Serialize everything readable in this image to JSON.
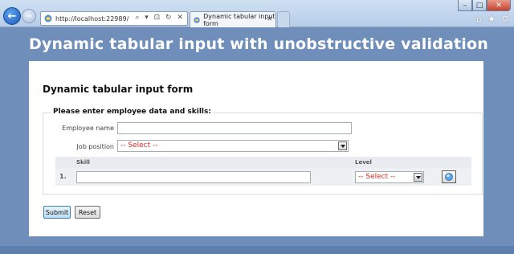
{
  "browser": {
    "address_url": "http://localhost:22989/",
    "address_tools": "⌕ ▾ ⊡ ↻ ✕",
    "tab_title": "Dynamic tabular input form",
    "tab_close": "✕",
    "back_label": "←",
    "fwd_label": "→",
    "minimize": "–",
    "maximize": "□",
    "close": "✕",
    "home_icon": "⌂",
    "favorites_icon": "★",
    "tools_icon": "⚙"
  },
  "site": {
    "title": "Dynamic tabular input with unobstructive validation"
  },
  "page": {
    "heading": "Dynamic tabular input form",
    "legend": "Please enter employee data and skills:",
    "employee_name_label": "Employee name",
    "employee_name_value": "",
    "job_position_label": "Job position",
    "job_position_selected": "-- Select --",
    "grid": {
      "headers": {
        "skill": "Skill",
        "level": "Level"
      },
      "rows": [
        {
          "number": "1.",
          "skill": "",
          "level": "-- Select --"
        }
      ]
    },
    "submit_label": "Submit",
    "reset_label": "Reset"
  },
  "colors": {
    "page_bg": "#6f8fba",
    "validation_red": "#e0281f"
  }
}
